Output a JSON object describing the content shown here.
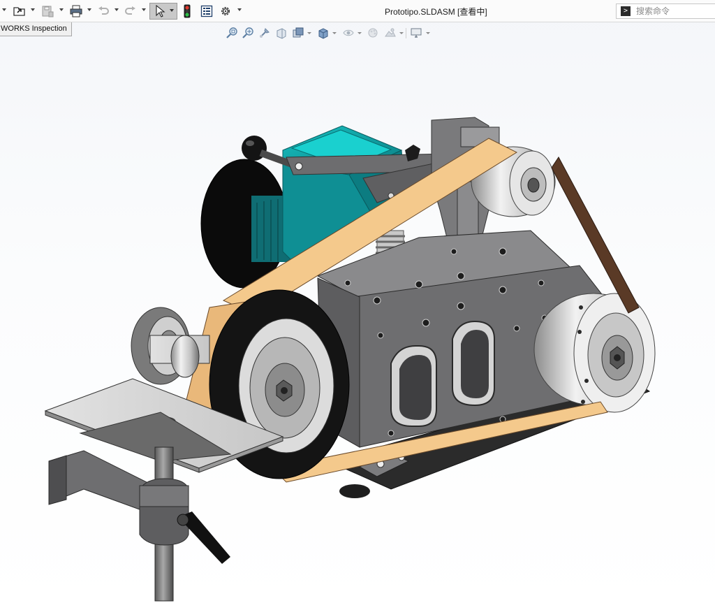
{
  "window": {
    "title": "Prototipo.SLDASM [查看中]"
  },
  "toolbar": {
    "items": [
      {
        "name": "new-document",
        "icon": "new-document-icon"
      },
      {
        "name": "open",
        "icon": "open-folder-icon"
      },
      {
        "name": "save",
        "icon": "save-icon"
      },
      {
        "name": "print",
        "icon": "printer-icon"
      },
      {
        "name": "undo",
        "icon": "undo-icon"
      },
      {
        "name": "redo",
        "icon": "redo-icon"
      },
      {
        "name": "select",
        "icon": "cursor-arrow-icon",
        "active": true
      },
      {
        "name": "rebuild",
        "icon": "traffic-light-icon"
      },
      {
        "name": "file-properties",
        "icon": "properties-list-icon"
      },
      {
        "name": "options",
        "icon": "gear-icon"
      }
    ]
  },
  "search": {
    "placeholder": "搜索命令",
    "icon": "command-prompt-icon"
  },
  "tooltip": {
    "text": "WORKS Inspection"
  },
  "view_toolbar": {
    "items": [
      "zoom-to-fit-icon",
      "zoom-to-area-icon",
      "previous-view-icon",
      "section-view-icon",
      "view-orientation-icon",
      "display-style-icon",
      "hide-show-items-icon",
      "edit-appearance-icon",
      "apply-scene-icon",
      "view-settings-icon"
    ]
  },
  "colors": {
    "motor_teal": "#14a7a7",
    "belt_tan": "#f4c98c",
    "belt_brown": "#5a3a26",
    "frame_gray": "#6e6e70",
    "background_top": "#f4f6f9"
  }
}
